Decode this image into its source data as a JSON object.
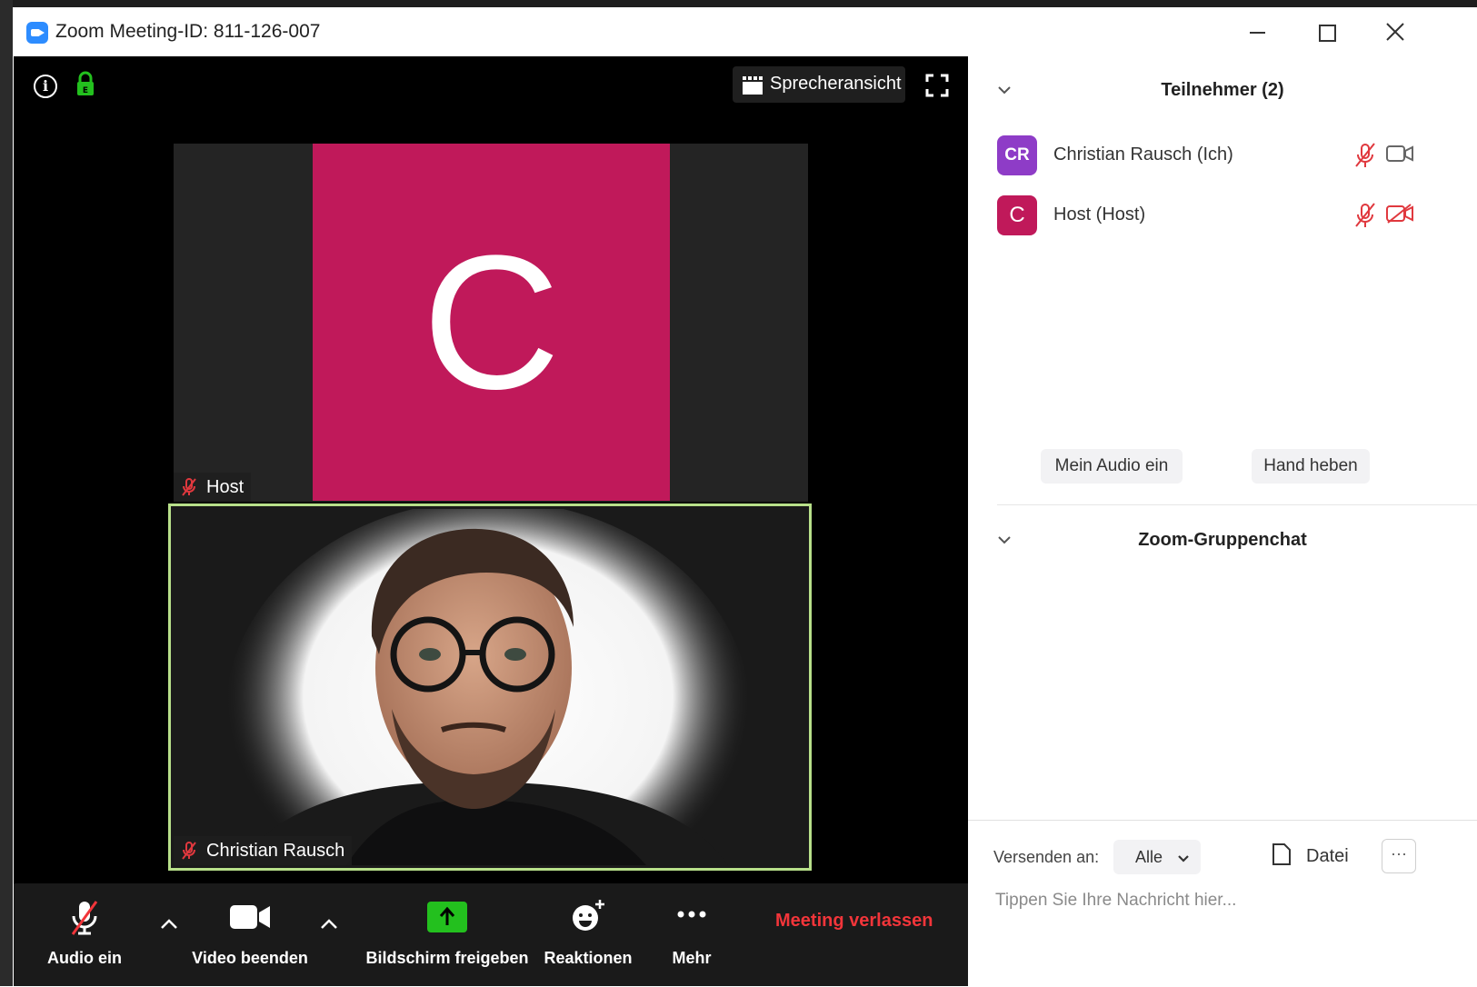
{
  "window": {
    "title": "Zoom Meeting-ID: 811-126-007"
  },
  "meeting": {
    "speaker_view_label": "Sprecheransicht",
    "host_tile": {
      "avatar_letter": "C",
      "avatar_color": "#c0195a",
      "name_label": "Host"
    },
    "self_tile": {
      "name_label": "Christian Rausch",
      "active_border_color": "#b8e08a"
    }
  },
  "toolbar": {
    "audio_label": "Audio ein",
    "video_label": "Video beenden",
    "share_label": "Bildschirm freigeben",
    "reactions_label": "Reaktionen",
    "more_label": "Mehr",
    "leave_label": "Meeting verlassen",
    "leave_color": "#f2353a",
    "share_color": "#23c01e"
  },
  "participants_panel": {
    "title": "Teilnehmer (2)",
    "participants": [
      {
        "initials": "CR",
        "name": "Christian Rausch (Ich)",
        "avatar_color": "#8e3cc7",
        "muted": true,
        "video": "on"
      },
      {
        "initials": "C",
        "name": "Host (Host)",
        "avatar_color": "#c0195a",
        "muted": true,
        "video": "off"
      }
    ],
    "unmute_button": "Mein Audio ein",
    "raise_hand_button": "Hand heben"
  },
  "chat_panel": {
    "title": "Zoom-Gruppenchat",
    "send_to_label": "Versenden an:",
    "send_to_value": "Alle",
    "file_label": "Datei",
    "more_label": "···",
    "input_placeholder": "Tippen Sie Ihre Nachricht hier..."
  }
}
